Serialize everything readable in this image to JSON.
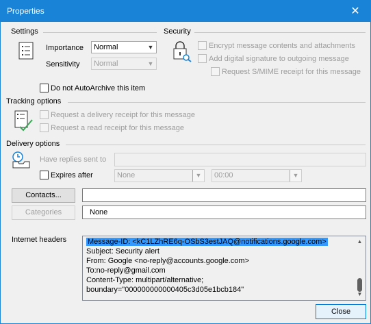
{
  "window": {
    "title": "Properties",
    "close_glyph": "✕"
  },
  "settings": {
    "title": "Settings",
    "importance_label": "Importance",
    "importance_value": "Normal",
    "sensitivity_label": "Sensitivity",
    "sensitivity_value": "Normal",
    "autoarchive_label": "Do not AutoArchive this item"
  },
  "security": {
    "title": "Security",
    "encrypt_label": "Encrypt message contents and attachments",
    "signature_label": "Add digital signature to outgoing message",
    "smime_label": "Request S/MIME receipt for this message"
  },
  "tracking": {
    "title": "Tracking options",
    "delivery_receipt_label": "Request a delivery receipt for this message",
    "read_receipt_label": "Request a read receipt for this message"
  },
  "delivery": {
    "title": "Delivery options",
    "replies_label": "Have replies sent to",
    "replies_value": "",
    "expires_label": "Expires after",
    "expires_date": "None",
    "expires_time": "00:00"
  },
  "contacts": {
    "button_label": "Contacts...",
    "value": ""
  },
  "categories": {
    "button_label": "Categories",
    "value": "None"
  },
  "internet_headers": {
    "label": "Internet headers",
    "lines": [
      "Message-ID: <kC1LZhRE6q-OSbS3estJAQ@notifications.google.com>",
      "Subject: Security alert",
      "From: Google <no-reply@accounts.google.com>",
      "To:no-reply@gmail.com",
      "Content-Type: multipart/alternative;",
      "boundary=\"000000000000405c3d05e1bcb184\""
    ]
  },
  "close_button_label": "Close",
  "icons": {
    "settings": "document-list-icon",
    "security": "lock-icon",
    "tracking": "checklist-icon",
    "delivery": "clock-tray-icon"
  },
  "colors": {
    "titlebar": "#1883d7",
    "selection": "#3399ff",
    "dialog_bg": "#f0f0f0"
  }
}
